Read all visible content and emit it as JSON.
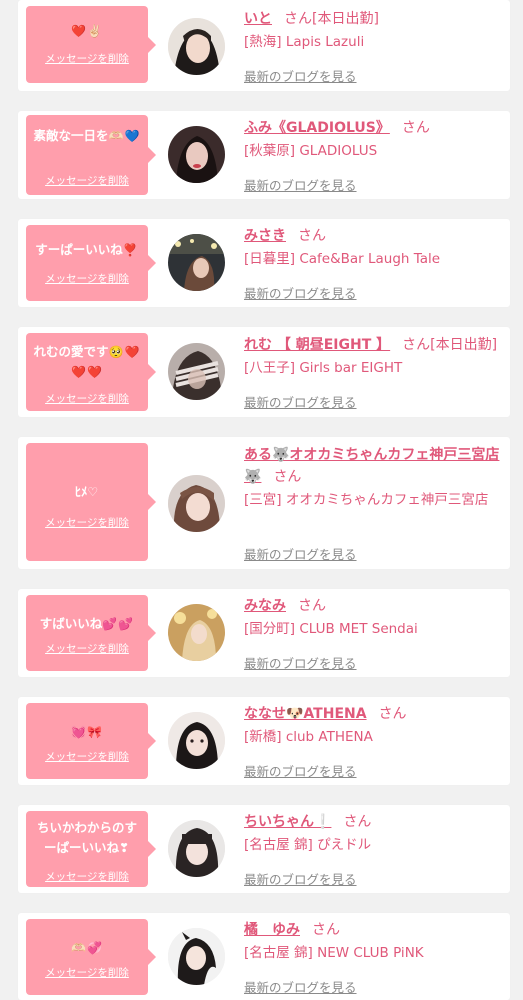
{
  "delete_label": "メッセージを削除",
  "blog_label": "最新のブログを見る",
  "san_label": "さん",
  "colors": {
    "bubble": "#ff9eac",
    "accent": "#e0587a",
    "blog_link": "#8a8a8a",
    "background": "#f1f1f1"
  },
  "messages": [
    {
      "message": "",
      "emoji": "❤️✌🏻",
      "name": "いと",
      "shift": "[本日出勤]",
      "shop": "[熱海] Lapis Lazuli"
    },
    {
      "message": "素敵な一日を",
      "emoji": "🫶🏻💙",
      "name": "ふみ《GLADIOLUS》",
      "shift": "",
      "shop": "[秋葉原] GLADIOLUS"
    },
    {
      "message": "すーぱーいいね",
      "emoji": "❣️",
      "name": "みさき",
      "shift": "",
      "shop": "[日暮里] Cafe&Bar Laugh Tale"
    },
    {
      "message": "れむの愛です",
      "emoji": "🥺❤️❤️❤️",
      "name": "れむ 【 朝昼EIGHT 】",
      "shift": "[本日出勤]",
      "shop": "[八王子] Girls bar EIGHT"
    },
    {
      "message": "ﾋﾒ",
      "emoji": "♡",
      "name": "ある🐺オオカミちゃんカフェ神戸三宮店🐺",
      "shift": "",
      "shop": "[三宮] オオカミちゃんカフェ神戸三宮店"
    },
    {
      "message": "すばいいね",
      "emoji": "💕💕",
      "name": "みなみ",
      "shift": "",
      "shop": "[国分町] CLUB MET Sendai"
    },
    {
      "message": "",
      "emoji": "💓🎀",
      "name": "ななせ🐶ATHENA",
      "shift": "",
      "shop": "[新橋] club ATHENA"
    },
    {
      "message": "ちいかわからのすーぱーいいね",
      "emoji": "❣",
      "name": "ちいちゃん❕",
      "shift": "",
      "shop": "[名古屋 錦] ぴえドル"
    },
    {
      "message": "",
      "emoji": "🫶🏻💞",
      "name": "橘　ゆみ",
      "shift": "",
      "shop": "[名古屋 錦] NEW CLUB PiNK"
    }
  ]
}
